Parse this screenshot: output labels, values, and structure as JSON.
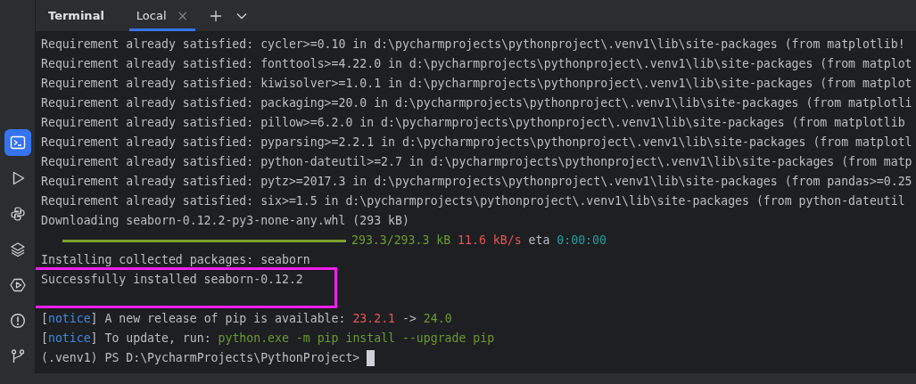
{
  "header": {
    "title": "Terminal",
    "tabs": [
      {
        "label": "Local",
        "selected": true,
        "close": "×"
      }
    ]
  },
  "sidebar": {
    "items": [
      {
        "selected": true
      },
      {
        "selected": false
      },
      {
        "selected": false
      },
      {
        "selected": false
      },
      {
        "selected": false
      },
      {
        "selected": false
      },
      {
        "selected": false
      }
    ]
  },
  "lines": [
    {
      "kind": "text",
      "segments": [
        {
          "text": "Requirement already satisfied: cycler>=0.10 in d:\\pycharmprojects\\pythonproject\\.venv1\\lib\\site-packages (from matplotlib!",
          "color": "#bcbec4"
        }
      ]
    },
    {
      "kind": "text",
      "segments": [
        {
          "text": "Requirement already satisfied: fonttools>=4.22.0 in d:\\pycharmprojects\\pythonproject\\.venv1\\lib\\site-packages (from matplot",
          "color": "#bcbec4"
        }
      ]
    },
    {
      "kind": "text",
      "segments": [
        {
          "text": "Requirement already satisfied: kiwisolver>=1.0.1 in d:\\pycharmprojects\\pythonproject\\.venv1\\lib\\site-packages (from matplot",
          "color": "#bcbec4"
        }
      ]
    },
    {
      "kind": "text",
      "segments": [
        {
          "text": "Requirement already satisfied: packaging>=20.0 in d:\\pycharmprojects\\pythonproject\\.venv1\\lib\\site-packages (from matplotli",
          "color": "#bcbec4"
        }
      ]
    },
    {
      "kind": "text",
      "segments": [
        {
          "text": "Requirement already satisfied: pillow>=6.2.0 in d:\\pycharmprojects\\pythonproject\\.venv1\\lib\\site-packages (from matplotlib",
          "color": "#bcbec4"
        }
      ]
    },
    {
      "kind": "text",
      "segments": [
        {
          "text": "Requirement already satisfied: pyparsing>=2.2.1 in d:\\pycharmprojects\\pythonproject\\.venv1\\lib\\site-packages (from matplotl",
          "color": "#bcbec4"
        }
      ]
    },
    {
      "kind": "text",
      "segments": [
        {
          "text": "Requirement already satisfied: python-dateutil>=2.7 in d:\\pycharmprojects\\pythonproject\\.venv1\\lib\\site-packages (from matp",
          "color": "#bcbec4"
        }
      ]
    },
    {
      "kind": "text",
      "segments": [
        {
          "text": "Requirement already satisfied: pytz>=2017.3 in d:\\pycharmprojects\\pythonproject\\.venv1\\lib\\site-packages (from pandas>=0.25",
          "color": "#bcbec4"
        }
      ]
    },
    {
      "kind": "text",
      "segments": [
        {
          "text": "Requirement already satisfied: six>=1.5 in d:\\pycharmprojects\\pythonproject\\.venv1\\lib\\site-packages (from python-dateutil",
          "color": "#bcbec4"
        }
      ]
    },
    {
      "kind": "text",
      "segments": [
        {
          "text": "Downloading seaborn-0.12.2-py3-none-any.whl (293 kB)",
          "color": "#bcbec4"
        }
      ]
    },
    {
      "kind": "progress",
      "level": 1,
      "segments": [
        {
          "text": "293.3/293.3 kB",
          "color": "#6a9a2f"
        },
        {
          "text": "11.6 kB/s",
          "color": "#e55353"
        },
        {
          "text": "eta",
          "color": "#bcbec4"
        },
        {
          "text": "0:00:00",
          "color": "#1ea0a0"
        }
      ]
    },
    {
      "kind": "text",
      "segments": [
        {
          "text": "Installing collected packages: seaborn",
          "color": "#bcbec4"
        }
      ]
    },
    {
      "kind": "text",
      "highlighted": true,
      "segments": [
        {
          "text": "Successfully installed seaborn-0.12.2",
          "color": "#bcbec4"
        }
      ]
    },
    {
      "kind": "blank"
    },
    {
      "kind": "text",
      "segments": [
        {
          "text": "[",
          "color": "#bcbec4"
        },
        {
          "text": "notice",
          "color": "#3d8be0",
          "joined": true
        },
        {
          "text": "] A new release of pip is available:",
          "color": "#bcbec4",
          "joined": true
        },
        {
          "text": "23.2.1",
          "color": "#e55353"
        },
        {
          "text": "->",
          "color": "#bcbec4"
        },
        {
          "text": "24.0",
          "color": "#6a9a2f"
        }
      ]
    },
    {
      "kind": "text",
      "segments": [
        {
          "text": "[",
          "color": "#bcbec4"
        },
        {
          "text": "notice",
          "color": "#3d8be0",
          "joined": true
        },
        {
          "text": "] To update, run:",
          "color": "#bcbec4",
          "joined": true
        },
        {
          "text": "python.exe -m pip install --upgrade pip",
          "color": "#6a9a2f"
        }
      ]
    },
    {
      "kind": "prompt",
      "segments": [
        {
          "text": "(.venv1) PS D:\\PycharmProjects\\PythonProject>",
          "color": "#bcbec4"
        }
      ]
    }
  ]
}
